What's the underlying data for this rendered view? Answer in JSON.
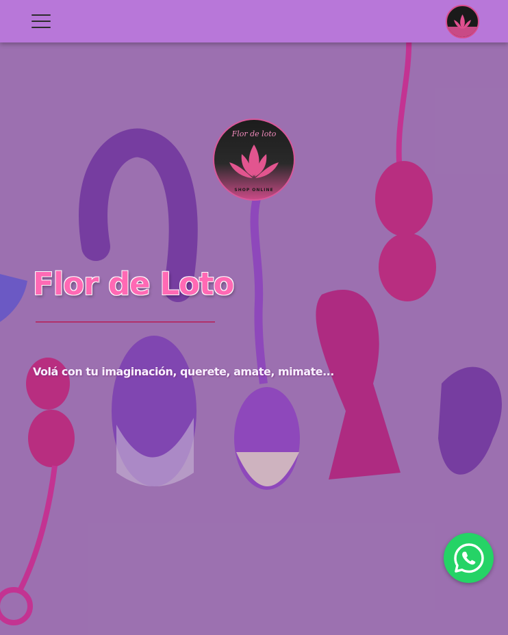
{
  "header": {
    "menu_icon": "hamburger-menu-icon",
    "logo_icon": "flor-de-loto-logo"
  },
  "hero": {
    "logo": {
      "top_text": "Flor de loto",
      "bottom_text": "SHOP ONLINE"
    },
    "title": "Flor de Loto",
    "subtitle": "Volá con tu imaginación, querete, amate, mimate..."
  },
  "floating": {
    "whatsapp_icon": "whatsapp-icon"
  },
  "colors": {
    "header_bg": "#b877d9",
    "title_pink": "#ff69b4",
    "divider": "#b0306a",
    "whatsapp_green": "#25d366"
  }
}
